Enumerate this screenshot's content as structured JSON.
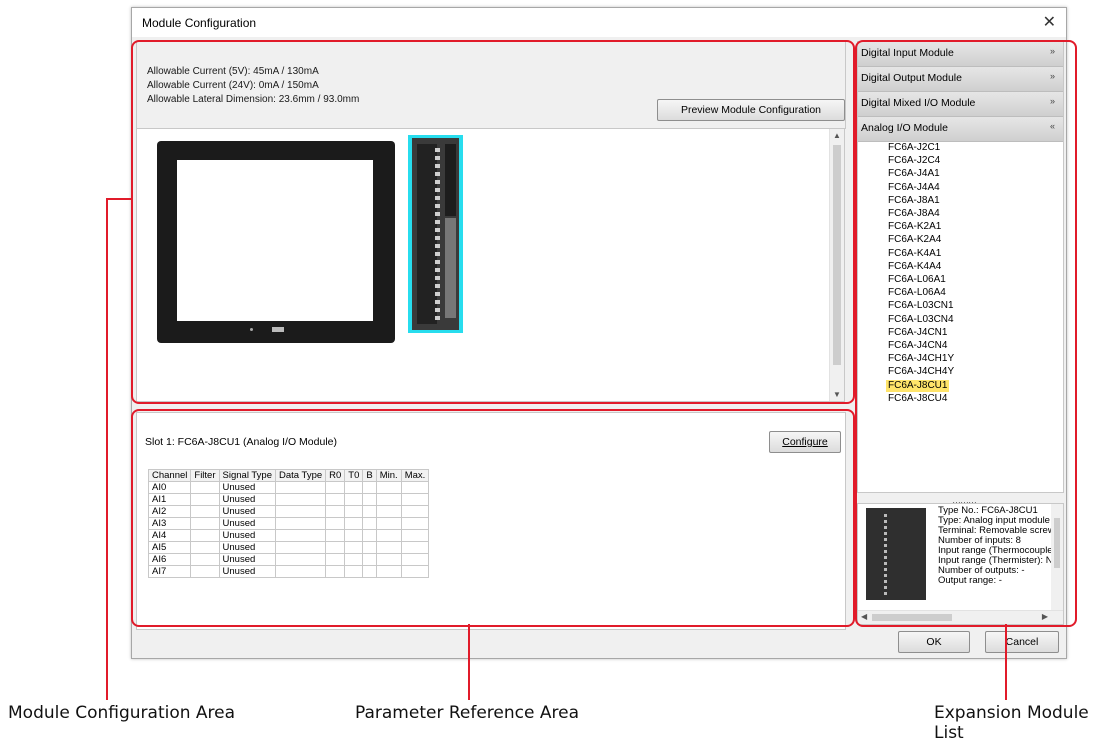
{
  "dialog": {
    "title": "Module Configuration",
    "close_glyph": "✕"
  },
  "config": {
    "lines": [
      "Allowable Current (5V): 45mA / 130mA",
      "Allowable Current (24V): 0mA / 150mA",
      "Allowable Lateral Dimension: 23.6mm / 93.0mm"
    ],
    "preview_button": "Preview Module Configuration",
    "splitter_glyph": "………"
  },
  "param": {
    "slot_label": "Slot 1: FC6A-J8CU1 (Analog I/O Module)",
    "configure_button": "Configure",
    "headers": [
      "Channel",
      "Filter",
      "Signal Type",
      "Data Type",
      "R0",
      "T0",
      "B",
      "Min.",
      "Max."
    ],
    "rows": [
      [
        "AI0",
        "",
        "Unused",
        "",
        "",
        "",
        "",
        "",
        ""
      ],
      [
        "AI1",
        "",
        "Unused",
        "",
        "",
        "",
        "",
        "",
        ""
      ],
      [
        "AI2",
        "",
        "Unused",
        "",
        "",
        "",
        "",
        "",
        ""
      ],
      [
        "AI3",
        "",
        "Unused",
        "",
        "",
        "",
        "",
        "",
        ""
      ],
      [
        "AI4",
        "",
        "Unused",
        "",
        "",
        "",
        "",
        "",
        ""
      ],
      [
        "AI5",
        "",
        "Unused",
        "",
        "",
        "",
        "",
        "",
        ""
      ],
      [
        "AI6",
        "",
        "Unused",
        "",
        "",
        "",
        "",
        "",
        ""
      ],
      [
        "AI7",
        "",
        "Unused",
        "",
        "",
        "",
        "",
        "",
        ""
      ]
    ]
  },
  "expansion": {
    "categories": [
      {
        "label": "Digital Input Module",
        "chevron": "»"
      },
      {
        "label": "Digital Output Module",
        "chevron": "»"
      },
      {
        "label": "Digital Mixed I/O Module",
        "chevron": "»"
      },
      {
        "label": "Analog I/O Module",
        "chevron": "«"
      }
    ],
    "items": [
      "FC6A-J2C1",
      "FC6A-J2C4",
      "FC6A-J4A1",
      "FC6A-J4A4",
      "FC6A-J8A1",
      "FC6A-J8A4",
      "FC6A-K2A1",
      "FC6A-K2A4",
      "FC6A-K4A1",
      "FC6A-K4A4",
      "FC6A-L06A1",
      "FC6A-L06A4",
      "FC6A-L03CN1",
      "FC6A-L03CN4",
      "FC6A-J4CN1",
      "FC6A-J4CN4",
      "FC6A-J4CH1Y",
      "FC6A-J4CH4Y",
      "FC6A-J8CU1",
      "FC6A-J8CU4"
    ],
    "selected": "FC6A-J8CU1",
    "details": [
      "Type No.: FC6A-J8CU1",
      "Type: Analog input module",
      "Terminal: Removable screw",
      "Number of inputs: 8",
      "Input range (Thermocouple",
      "Input range (Thermister): N",
      "Number of outputs: -",
      "Output range: -"
    ]
  },
  "footer": {
    "ok": "OK",
    "cancel": "Cancel"
  },
  "callouts": {
    "config_area": "Module Configuration Area",
    "param_area": "Parameter Reference Area",
    "expansion_list": "Expansion Module List"
  },
  "colors": {
    "highlight": "#e11b2a",
    "module_highlight": "#27ddee",
    "selected_item": "#ffe46a"
  }
}
